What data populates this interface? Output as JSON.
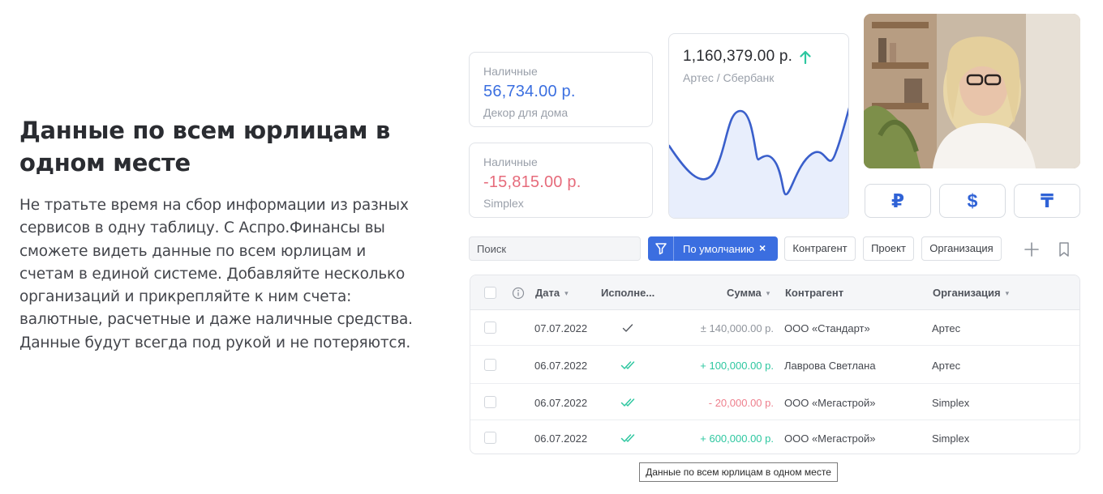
{
  "hero": {
    "title": "Данные по всем юрлицам в одном месте",
    "text": "Не тратьте время на сбор информации из разных сервисов в одну таблицу. С Аспро.Финансы вы сможете видеть данные по всем юрлицам и счетам в единой системе. Добавляйте несколько организаций и прикрепляйте к ним счета: валютные, расчетные и даже наличные средства. Данные будут всегда под рукой и не потеряются."
  },
  "cards": [
    {
      "label": "Наличные",
      "amount": "56,734.00 р.",
      "company": "Декор для дома",
      "tone": "positive"
    },
    {
      "label": "Наличные",
      "amount": "-15,815.00 р.",
      "company": "Simplex",
      "tone": "negative"
    }
  ],
  "balance_card": {
    "amount": "1,160,379.00 р.",
    "subtitle": "Артес / Сбербанк",
    "trend": "up",
    "trend_color": "#2ec7a0",
    "line_color": "#3a5fcb",
    "fill_color": "#e8eefc"
  },
  "currencies": [
    "₽",
    "$",
    "₸"
  ],
  "toolbar": {
    "search_placeholder": "Поиск",
    "active_filter": "По умолчанию",
    "remove_symbol": "×",
    "chips": [
      "Контрагент",
      "Проект",
      "Организация"
    ]
  },
  "table": {
    "columns": {
      "date": "Дата",
      "executed": "Исполне...",
      "sum": "Сумма",
      "counterparty": "Контрагент",
      "organization": "Организация"
    },
    "rows": [
      {
        "date": "07.07.2022",
        "status": "single-check",
        "sum": "± 140,000.00 р.",
        "sum_type": "neutral",
        "counterparty": "ООО «Стандарт»",
        "organization": "Артес"
      },
      {
        "date": "06.07.2022",
        "status": "double-check",
        "sum": "+ 100,000.00 р.",
        "sum_type": "income",
        "counterparty": "Лаврова Светлана",
        "organization": "Артес"
      },
      {
        "date": "06.07.2022",
        "status": "double-check",
        "sum": "- 20,000.00 р.",
        "sum_type": "expense",
        "counterparty": "ООО «Мегастрой»",
        "organization": "Simplex"
      },
      {
        "date": "06.07.2022",
        "status": "double-check",
        "sum": "+ 600,000.00 р.",
        "sum_type": "income",
        "counterparty": "ООО «Мегастрой»",
        "organization": "Simplex"
      }
    ]
  },
  "tooltip": "Данные по всем юрлицам в одном месте"
}
